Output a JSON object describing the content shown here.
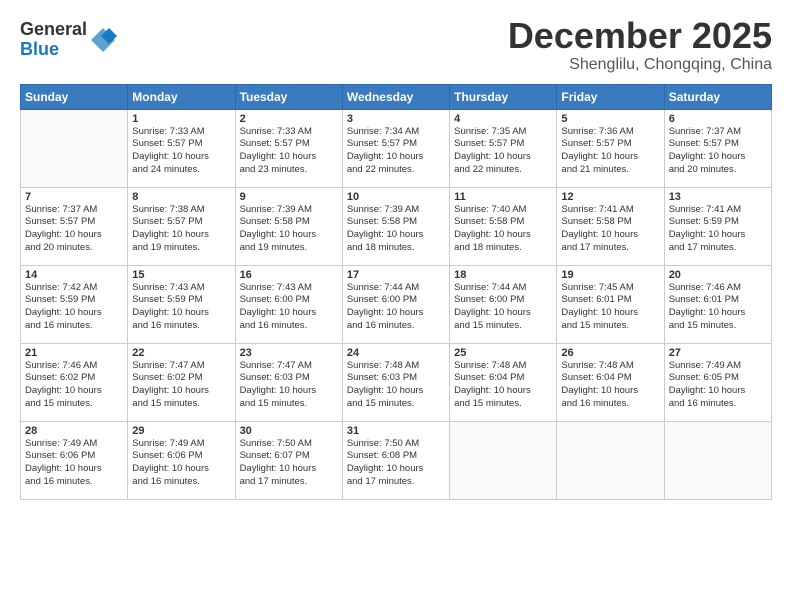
{
  "header": {
    "logo_general": "General",
    "logo_blue": "Blue",
    "month_title": "December 2025",
    "location": "Shenglilu, Chongqing, China"
  },
  "weekdays": [
    "Sunday",
    "Monday",
    "Tuesday",
    "Wednesday",
    "Thursday",
    "Friday",
    "Saturday"
  ],
  "weeks": [
    [
      {
        "day": "",
        "info": ""
      },
      {
        "day": "1",
        "info": "Sunrise: 7:33 AM\nSunset: 5:57 PM\nDaylight: 10 hours\nand 24 minutes."
      },
      {
        "day": "2",
        "info": "Sunrise: 7:33 AM\nSunset: 5:57 PM\nDaylight: 10 hours\nand 23 minutes."
      },
      {
        "day": "3",
        "info": "Sunrise: 7:34 AM\nSunset: 5:57 PM\nDaylight: 10 hours\nand 22 minutes."
      },
      {
        "day": "4",
        "info": "Sunrise: 7:35 AM\nSunset: 5:57 PM\nDaylight: 10 hours\nand 22 minutes."
      },
      {
        "day": "5",
        "info": "Sunrise: 7:36 AM\nSunset: 5:57 PM\nDaylight: 10 hours\nand 21 minutes."
      },
      {
        "day": "6",
        "info": "Sunrise: 7:37 AM\nSunset: 5:57 PM\nDaylight: 10 hours\nand 20 minutes."
      }
    ],
    [
      {
        "day": "7",
        "info": "Sunrise: 7:37 AM\nSunset: 5:57 PM\nDaylight: 10 hours\nand 20 minutes."
      },
      {
        "day": "8",
        "info": "Sunrise: 7:38 AM\nSunset: 5:57 PM\nDaylight: 10 hours\nand 19 minutes."
      },
      {
        "day": "9",
        "info": "Sunrise: 7:39 AM\nSunset: 5:58 PM\nDaylight: 10 hours\nand 19 minutes."
      },
      {
        "day": "10",
        "info": "Sunrise: 7:39 AM\nSunset: 5:58 PM\nDaylight: 10 hours\nand 18 minutes."
      },
      {
        "day": "11",
        "info": "Sunrise: 7:40 AM\nSunset: 5:58 PM\nDaylight: 10 hours\nand 18 minutes."
      },
      {
        "day": "12",
        "info": "Sunrise: 7:41 AM\nSunset: 5:58 PM\nDaylight: 10 hours\nand 17 minutes."
      },
      {
        "day": "13",
        "info": "Sunrise: 7:41 AM\nSunset: 5:59 PM\nDaylight: 10 hours\nand 17 minutes."
      }
    ],
    [
      {
        "day": "14",
        "info": "Sunrise: 7:42 AM\nSunset: 5:59 PM\nDaylight: 10 hours\nand 16 minutes."
      },
      {
        "day": "15",
        "info": "Sunrise: 7:43 AM\nSunset: 5:59 PM\nDaylight: 10 hours\nand 16 minutes."
      },
      {
        "day": "16",
        "info": "Sunrise: 7:43 AM\nSunset: 6:00 PM\nDaylight: 10 hours\nand 16 minutes."
      },
      {
        "day": "17",
        "info": "Sunrise: 7:44 AM\nSunset: 6:00 PM\nDaylight: 10 hours\nand 16 minutes."
      },
      {
        "day": "18",
        "info": "Sunrise: 7:44 AM\nSunset: 6:00 PM\nDaylight: 10 hours\nand 15 minutes."
      },
      {
        "day": "19",
        "info": "Sunrise: 7:45 AM\nSunset: 6:01 PM\nDaylight: 10 hours\nand 15 minutes."
      },
      {
        "day": "20",
        "info": "Sunrise: 7:46 AM\nSunset: 6:01 PM\nDaylight: 10 hours\nand 15 minutes."
      }
    ],
    [
      {
        "day": "21",
        "info": "Sunrise: 7:46 AM\nSunset: 6:02 PM\nDaylight: 10 hours\nand 15 minutes."
      },
      {
        "day": "22",
        "info": "Sunrise: 7:47 AM\nSunset: 6:02 PM\nDaylight: 10 hours\nand 15 minutes."
      },
      {
        "day": "23",
        "info": "Sunrise: 7:47 AM\nSunset: 6:03 PM\nDaylight: 10 hours\nand 15 minutes."
      },
      {
        "day": "24",
        "info": "Sunrise: 7:48 AM\nSunset: 6:03 PM\nDaylight: 10 hours\nand 15 minutes."
      },
      {
        "day": "25",
        "info": "Sunrise: 7:48 AM\nSunset: 6:04 PM\nDaylight: 10 hours\nand 15 minutes."
      },
      {
        "day": "26",
        "info": "Sunrise: 7:48 AM\nSunset: 6:04 PM\nDaylight: 10 hours\nand 16 minutes."
      },
      {
        "day": "27",
        "info": "Sunrise: 7:49 AM\nSunset: 6:05 PM\nDaylight: 10 hours\nand 16 minutes."
      }
    ],
    [
      {
        "day": "28",
        "info": "Sunrise: 7:49 AM\nSunset: 6:06 PM\nDaylight: 10 hours\nand 16 minutes."
      },
      {
        "day": "29",
        "info": "Sunrise: 7:49 AM\nSunset: 6:06 PM\nDaylight: 10 hours\nand 16 minutes."
      },
      {
        "day": "30",
        "info": "Sunrise: 7:50 AM\nSunset: 6:07 PM\nDaylight: 10 hours\nand 17 minutes."
      },
      {
        "day": "31",
        "info": "Sunrise: 7:50 AM\nSunset: 6:08 PM\nDaylight: 10 hours\nand 17 minutes."
      },
      {
        "day": "",
        "info": ""
      },
      {
        "day": "",
        "info": ""
      },
      {
        "day": "",
        "info": ""
      }
    ]
  ]
}
